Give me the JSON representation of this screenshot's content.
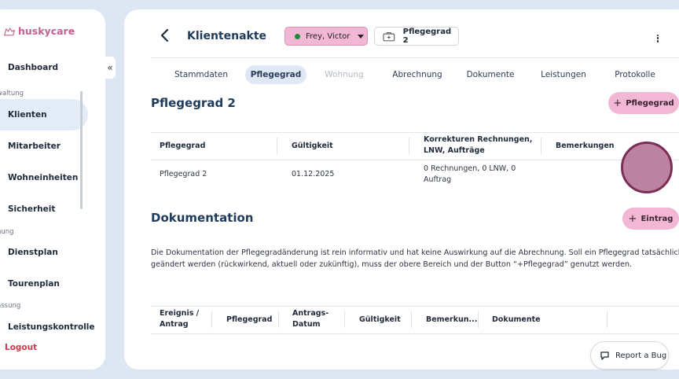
{
  "sidebar": {
    "brand": "huskycare",
    "collapse_icon": "«",
    "items": [
      {
        "label": "Dashboard"
      },
      {
        "section": "waltung"
      },
      {
        "label": "Klienten"
      },
      {
        "label": "Mitarbeiter"
      },
      {
        "label": "Wohneinheiten"
      },
      {
        "label": "Sicherheit"
      },
      {
        "section": "nung"
      },
      {
        "label": "Dienstplan"
      },
      {
        "label": "Tourenplan"
      },
      {
        "section": "assung"
      },
      {
        "label": "Leistungskontrolle"
      }
    ],
    "logout": "Logout"
  },
  "header": {
    "title": "Klientenakte",
    "client": "Frey, Victor",
    "care_level_badge": "Pflegegrad 2"
  },
  "tabs": [
    {
      "label": "Stammdaten"
    },
    {
      "label": "Pflegegrad"
    },
    {
      "label": "Wohnung"
    },
    {
      "label": "Abrechnung"
    },
    {
      "label": "Dokumente"
    },
    {
      "label": "Leistungen"
    },
    {
      "label": "Protokolle"
    }
  ],
  "care": {
    "title": "Pflegegrad 2",
    "add_label": "Pflegegrad",
    "columns": [
      "Pflegegrad",
      "Gültigkeit",
      "Korrekturen Rechnungen, LNW, Aufträge",
      "Bemerkungen"
    ],
    "rows": [
      [
        "Pflegegrad 2",
        "01.12.2025",
        "0 Rechnungen, 0 LNW, 0 Auftrag",
        ""
      ]
    ]
  },
  "documentation": {
    "title": "Dokumentation",
    "add_label": "Eintrag",
    "text": "Die Dokumentation der Pflegegradänderung ist rein informativ und hat keine Auswirkung auf die Abrechnung. Soll ein Pflegegrad tatsächlich geändert werden (rückwirkend, aktuell oder zukünftig), muss der obere Bereich und der Button “+Pflegegrad” genutzt werden.",
    "columns": [
      "Ereignis / Antrag",
      "Pflegegrad",
      "Antrags-Datum",
      "Gültigkeit",
      "Bemerkun...",
      "Dokumente"
    ]
  },
  "report_bug": "Report a Bug"
}
